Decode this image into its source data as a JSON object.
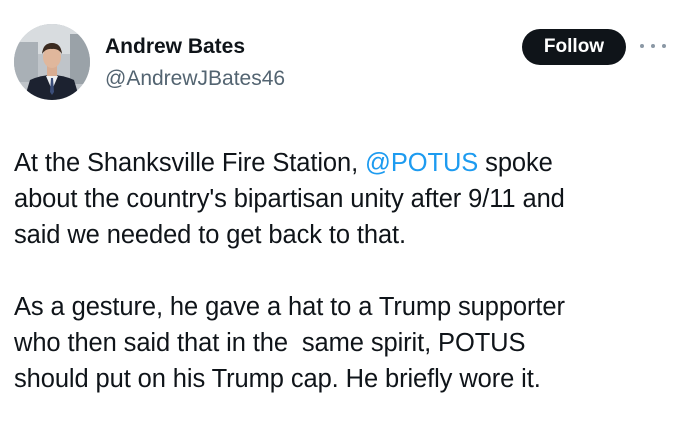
{
  "author": {
    "display_name": "Andrew Bates",
    "handle": "@AndrewJBates46"
  },
  "actions": {
    "follow_label": "Follow"
  },
  "tweet": {
    "paragraph1": {
      "line1_before": "At the Shanksville Fire Station, ",
      "line1_mention": "@POTUS",
      "line1_after": " spoke",
      "line2": "about the country's bipartisan unity after 9/11 and",
      "line3": "said we needed to get back to that."
    },
    "paragraph2": {
      "line1": "As a gesture, he gave a hat to a Trump supporter",
      "line2": "who then said that in the  same spirit, POTUS",
      "line3": "should put on his Trump cap. He briefly wore it."
    }
  },
  "colors": {
    "text": "#0f1419",
    "secondary": "#536471",
    "link": "#1d9bf0",
    "button_bg": "#0f1419",
    "button_text": "#ffffff"
  }
}
